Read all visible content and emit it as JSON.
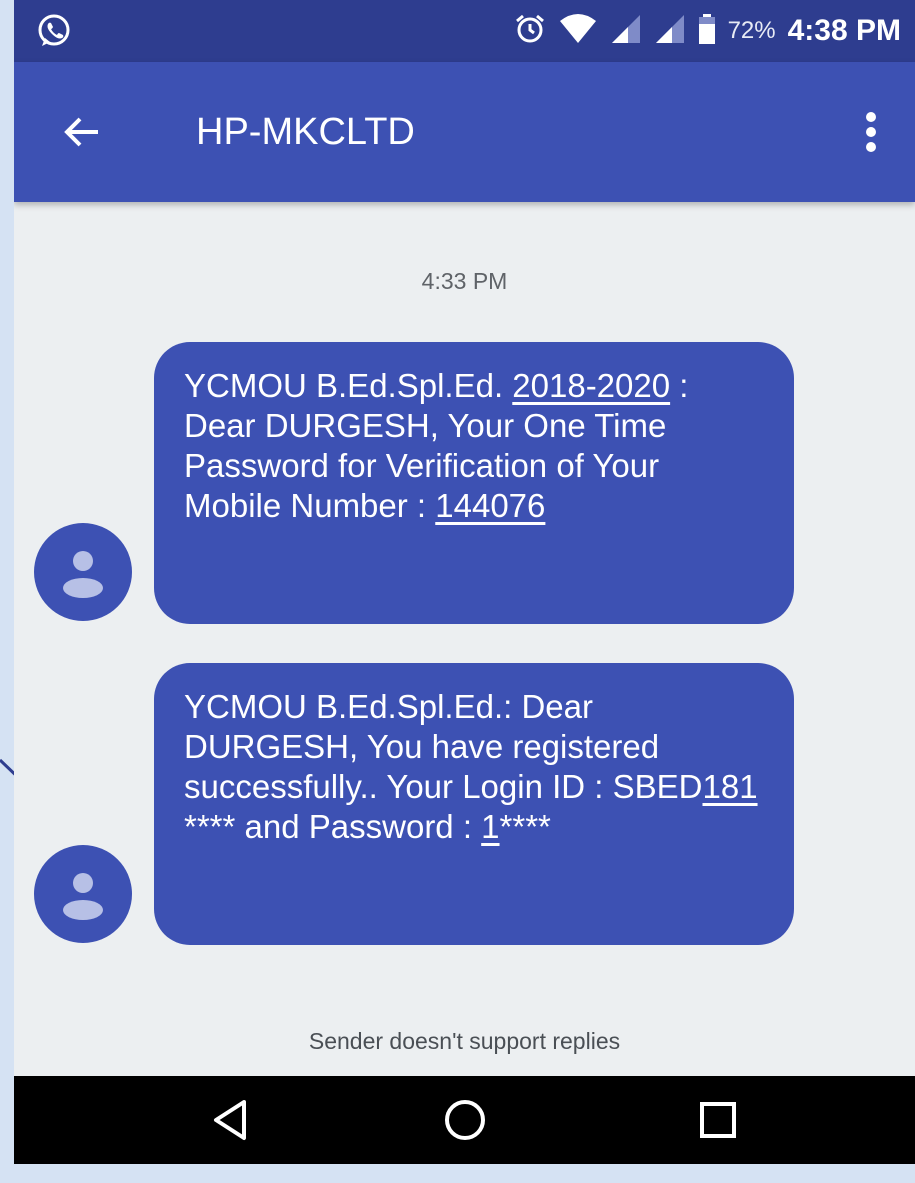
{
  "status_bar": {
    "battery": "72%",
    "time": "4:38 PM"
  },
  "app_bar": {
    "title": "HP-MKCLTD"
  },
  "conversation": {
    "timestamp": "4:33 PM",
    "messages": [
      {
        "parts": [
          "YCMOU B.Ed.Spl.Ed. ",
          "2018-2020",
          " : Dear DURGESH, Your One Time Password for Verification of Your Mobile Number : ",
          "144076"
        ]
      },
      {
        "parts": [
          "YCMOU B.Ed.Spl.Ed.: Dear DURGESH, You have registered successfully.. Your Login ID : SBED",
          "181",
          " **** and Password : ",
          "1",
          "****"
        ]
      }
    ],
    "reply_note": "Sender doesn't support replies"
  },
  "colors": {
    "status_bar": "#2e3d8f",
    "app_bar": "#3d51b3",
    "bubble": "#3d51b3",
    "background": "#eceff1",
    "nav_bar": "#000000"
  },
  "icons": {
    "status_left": "whatsapp-icon",
    "status_right": [
      "alarm-icon",
      "wifi-icon",
      "signal-icon",
      "signal-icon",
      "battery-icon"
    ],
    "app_bar": [
      "back-arrow-icon",
      "overflow-menu-icon"
    ],
    "avatar": "person-icon",
    "nav": [
      "nav-back-icon",
      "nav-home-icon",
      "nav-recents-icon"
    ]
  }
}
